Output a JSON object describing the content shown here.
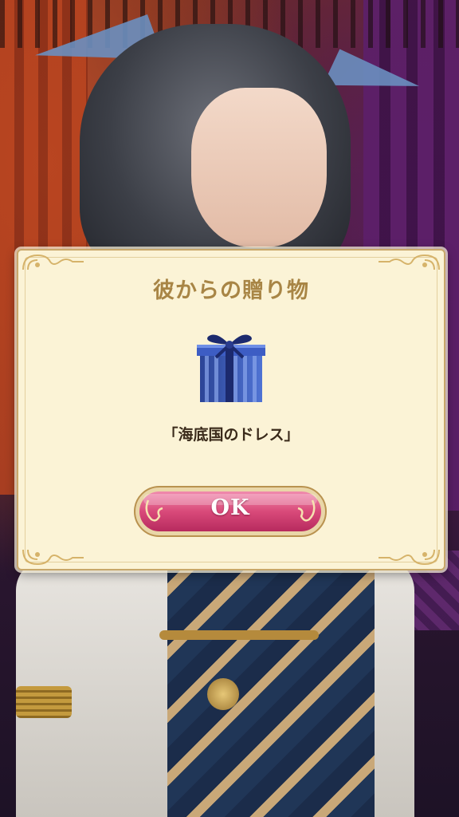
{
  "dialog": {
    "title": "彼からの贈り物",
    "gift_icon": "gift-box-icon",
    "item_name": "「海底国のドレス」",
    "ok_label": "OK"
  },
  "colors": {
    "panel_bg": "#fbf3d6",
    "title": "#a88545",
    "button": "#d94a7a",
    "gift_box": "#3b5fc0"
  }
}
